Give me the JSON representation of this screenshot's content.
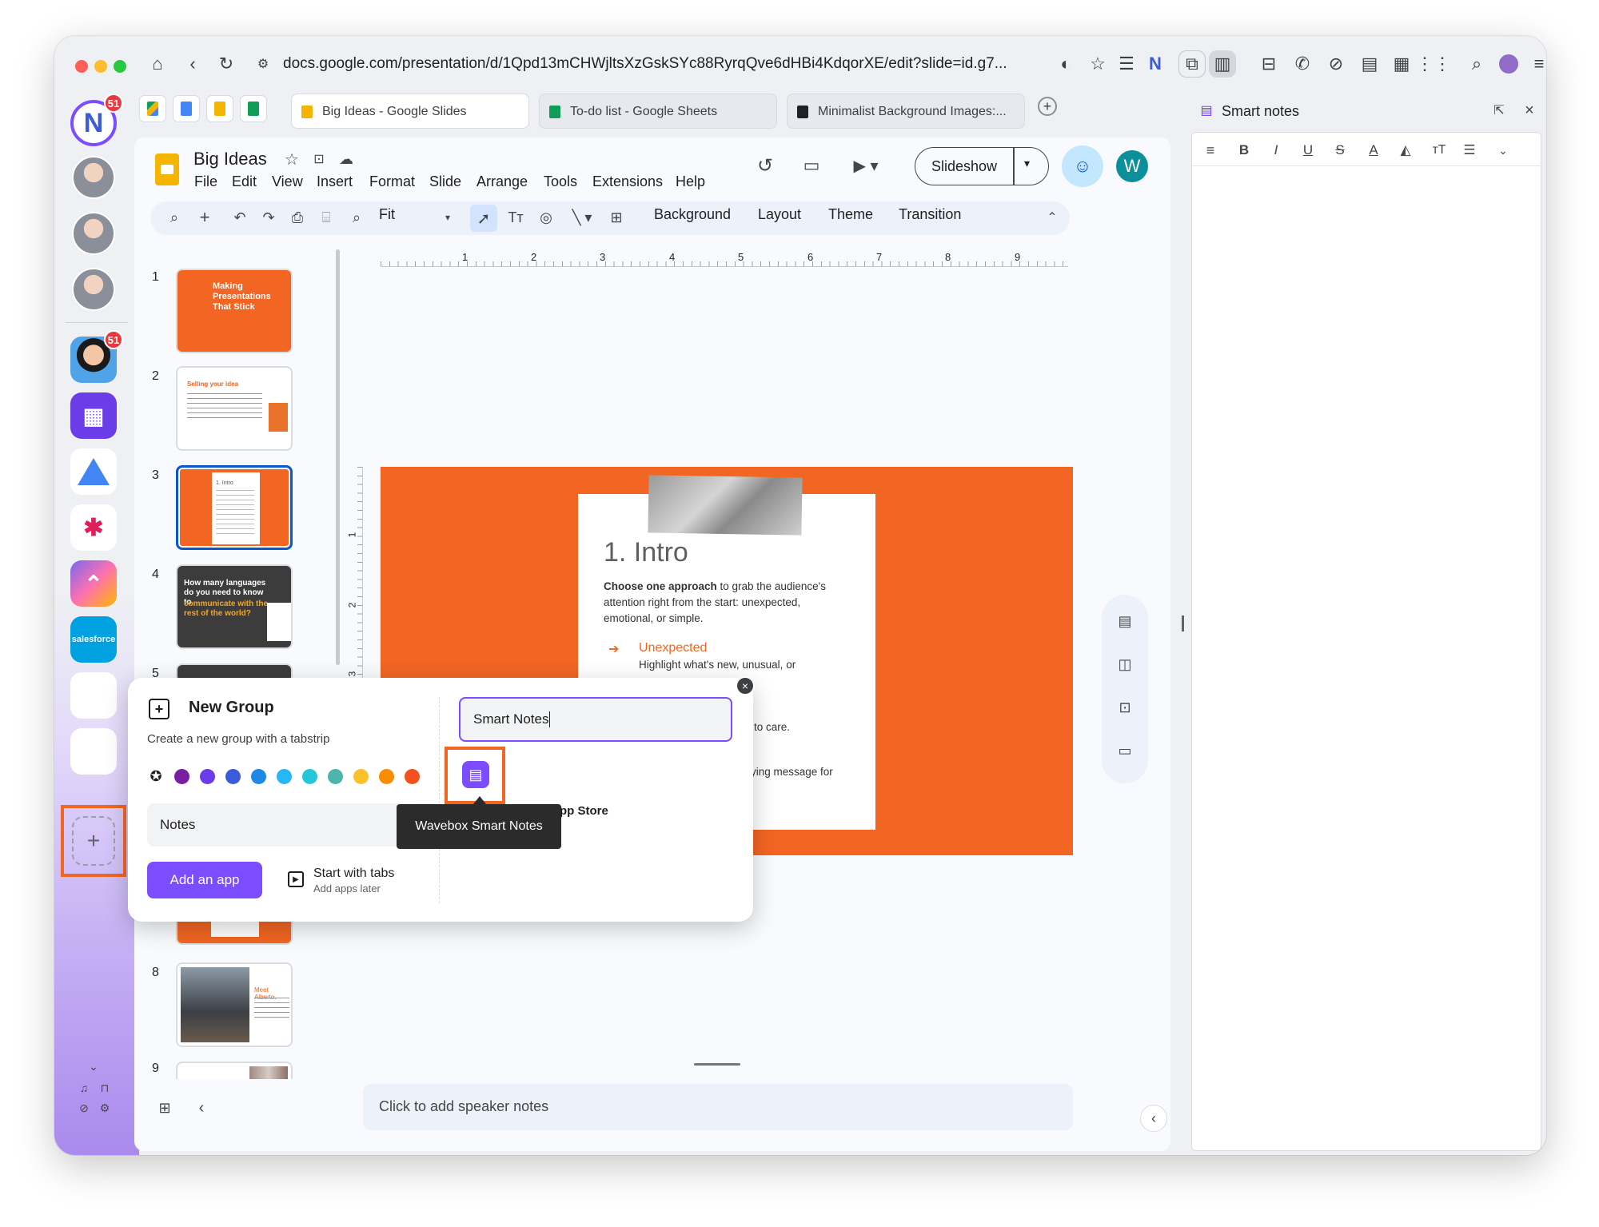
{
  "browser": {
    "url": "docs.google.com/presentation/d/1Qpd13mCHWjltsXzGskSYc88RyrqQve6dHBi4KdqorXE/edit?slide=id.g7...",
    "tabs": [
      {
        "label": "Big Ideas - Google Slides",
        "color": "#f4b400"
      },
      {
        "label": "To-do list - Google Sheets",
        "color": "#0f9d58"
      },
      {
        "label": "Minimalist Background Images:...",
        "color": "#202124"
      }
    ],
    "sidebar_badges": [
      "51",
      "51"
    ]
  },
  "slides_app": {
    "doc_title": "Big Ideas",
    "menus": [
      "File",
      "Edit",
      "View",
      "Insert",
      "Format",
      "Slide",
      "Arrange",
      "Tools",
      "Extensions",
      "Help"
    ],
    "slideshow_label": "Slideshow",
    "user_initial": "W",
    "toolbar": {
      "zoom": "Fit",
      "background": "Background",
      "layout": "Layout",
      "theme": "Theme",
      "transition": "Transition"
    },
    "ruler_ticks": [
      "1",
      "2",
      "3",
      "4",
      "5",
      "6",
      "7",
      "8",
      "9"
    ],
    "vruler_ticks": [
      "1",
      "2",
      "3"
    ],
    "slide_numbers": [
      "1",
      "2",
      "3",
      "4",
      "5",
      "8",
      "9"
    ],
    "thumbs": {
      "s1_title": "Making Presentations That Stick",
      "s2_title": "Selling your idea",
      "s3_title": "1. Intro",
      "s4_title": "How many languages do you need to know to",
      "s4_highlight": "communicate with the rest of the world?",
      "s8_title": "Meet Alberto."
    },
    "slide": {
      "heading": "1. Intro",
      "body_bold": "Choose one approach",
      "body_rest": " to grab the audience's attention right from the start: unexpected, emotional, or simple.",
      "bullet_title": "Unexpected",
      "bullet_text": "Highlight what's new, unusual, or",
      "partial_1": "to care.",
      "partial_2": "ying message for"
    },
    "speaker_notes": "Click to add speaker notes"
  },
  "smart_notes_panel": {
    "title": "Smart notes",
    "format_buttons": [
      "B",
      "I",
      "U",
      "S",
      "A"
    ]
  },
  "new_group_popup": {
    "title": "New Group",
    "subtitle": "Create a new group with a tabstrip",
    "colors": [
      "#202124",
      "#7b1fa2",
      "#6a3de8",
      "#3b5bdb",
      "#1e88e5",
      "#29b6f6",
      "#26c6da",
      "#4db6ac",
      "#fbc02d",
      "#fb8c00",
      "#f4511e"
    ],
    "name_value": "Notes",
    "add_app_label": "Add an app",
    "start_tabs_label": "Start with tabs",
    "start_tabs_sub": "Add apps later",
    "search_value": "Smart Notes",
    "tooltip": "Wavebox Smart Notes",
    "app_store_partial": "pp Store"
  },
  "colors": {
    "accent": "#7c4dff",
    "slide_orange": "#f26522",
    "highlight_box": "#f26522"
  }
}
